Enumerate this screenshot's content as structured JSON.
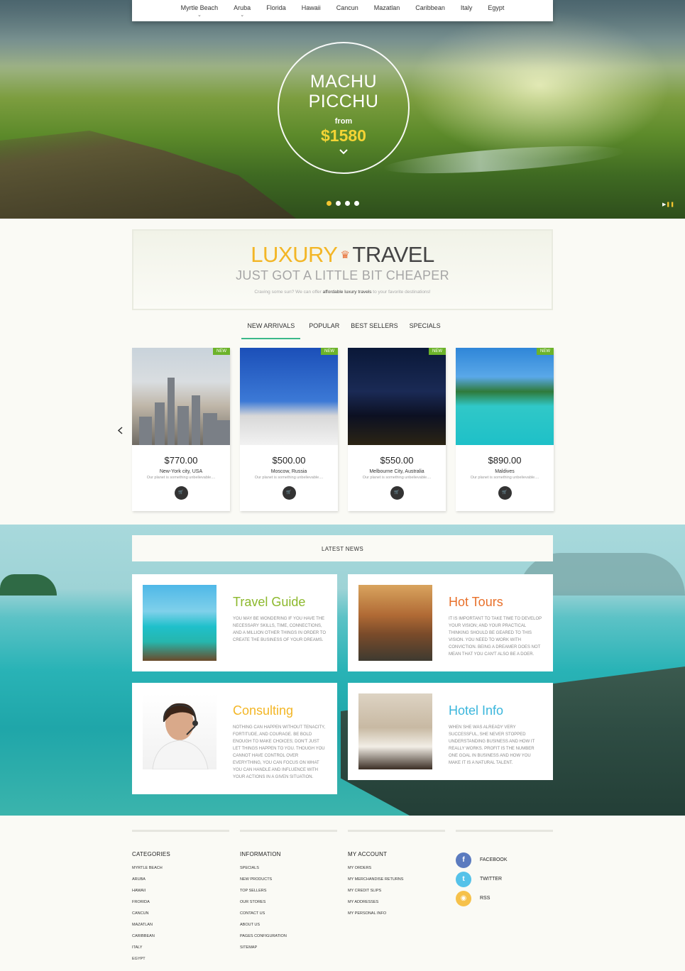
{
  "nav": {
    "items": [
      {
        "label": "Myrtle Beach",
        "has_dropdown": true
      },
      {
        "label": "Aruba",
        "has_dropdown": true
      },
      {
        "label": "Florida",
        "has_dropdown": false
      },
      {
        "label": "Hawaii",
        "has_dropdown": false
      },
      {
        "label": "Cancun",
        "has_dropdown": false
      },
      {
        "label": "Mazatlan",
        "has_dropdown": false
      },
      {
        "label": "Caribbean",
        "has_dropdown": false
      },
      {
        "label": "Italy",
        "has_dropdown": false
      },
      {
        "label": "Egypt",
        "has_dropdown": false
      }
    ]
  },
  "hero": {
    "title_line1": "MACHU",
    "title_line2": "PICCHU",
    "from_label": "from",
    "price": "$1580",
    "slide_count": 4,
    "active_slide": 1
  },
  "banner": {
    "word1": "LUXURY",
    "word2": "TRAVEL",
    "subtitle": "JUST GOT A LITTLE BIT CHEAPER",
    "text_before": "Craving some sun? We can offer ",
    "text_bold": "affordable luxury travels",
    "text_after": " to your favorite destinations!"
  },
  "tabs": [
    {
      "label": "NEW ARRIVALS",
      "active": true
    },
    {
      "label": "POPULAR",
      "active": false
    },
    {
      "label": "BEST SELLERS",
      "active": false
    },
    {
      "label": "SPECIALS",
      "active": false
    }
  ],
  "products": [
    {
      "badge": "NEW",
      "price": "$770.00",
      "name": "New-York city, USA",
      "desc": "Our planet is something unbelievable....",
      "image": "new-york-skyline"
    },
    {
      "badge": "NEW",
      "price": "$500.00",
      "name": "Moscow, Russia",
      "desc": "Our planet is something unbelievable....",
      "image": "moscow-kremlin"
    },
    {
      "badge": "NEW",
      "price": "$550.00",
      "name": "Melbourne City, Australia",
      "desc": "Our planet is something unbelievable....",
      "image": "melbourne-night"
    },
    {
      "badge": "NEW",
      "price": "$890.00",
      "name": "Maldives",
      "desc": "Our planet is something unbelievable....",
      "image": "maldives-bungalows"
    }
  ],
  "latest_news": {
    "heading": "LATEST NEWS",
    "items": [
      {
        "title": "Travel Guide",
        "color": "#8cb82c",
        "text": "You may be wondering if you have the necessary skills, time, connections, and a million other things in order to create the business of your dreams."
      },
      {
        "title": "Hot Tours",
        "color": "#e8702a",
        "text": "It is important to take time to develop your vision; and your practical thinking should be geared to this vision. You need to work with conviction. Being a dreamer does not mean that you can't also be a doer."
      },
      {
        "title": "Consulting",
        "color": "#f3b626",
        "text": "Nothing can happen without tenacity, fortitude, and courage. Be bold enough to make choices; don't just let things happen to you. Though you cannot have control over everything, you can focus on what you can handle and influence with your actions in a given situation."
      },
      {
        "title": "Hotel Info",
        "color": "#3ab6dc",
        "text": "When she was already very successful, she never stopped understanding business and how it really works. Profit is the number one goal in business and how you make it is a natural talent."
      }
    ]
  },
  "footer": {
    "columns": [
      {
        "heading": "CATEGORIES",
        "items": [
          "Myrtle Beach",
          "Aruba",
          "Hawaii",
          "Frorida",
          "Cancun",
          "Mazatlan",
          "Caribbean",
          "Italy",
          "Egypt"
        ]
      },
      {
        "heading": "INFORMATION",
        "items": [
          "Specials",
          "New products",
          "Top sellers",
          "Our stores",
          "Contact us",
          "About us",
          "Pages configuration",
          "Sitemap"
        ]
      },
      {
        "heading": "MY ACCOUNT",
        "items": [
          "My orders",
          "My merchandise returns",
          "My credit slips",
          "My addresses",
          "My personal info"
        ]
      }
    ],
    "social": [
      {
        "label": "FACEBOOK",
        "icon": "facebook-icon",
        "glyph": "f",
        "color": "#5b7bbf"
      },
      {
        "label": "TWITTER",
        "icon": "twitter-icon",
        "glyph": "t",
        "color": "#55c2e9"
      },
      {
        "label": "RSS",
        "icon": "rss-icon",
        "glyph": "◉",
        "color": "#f6c14a"
      }
    ]
  }
}
